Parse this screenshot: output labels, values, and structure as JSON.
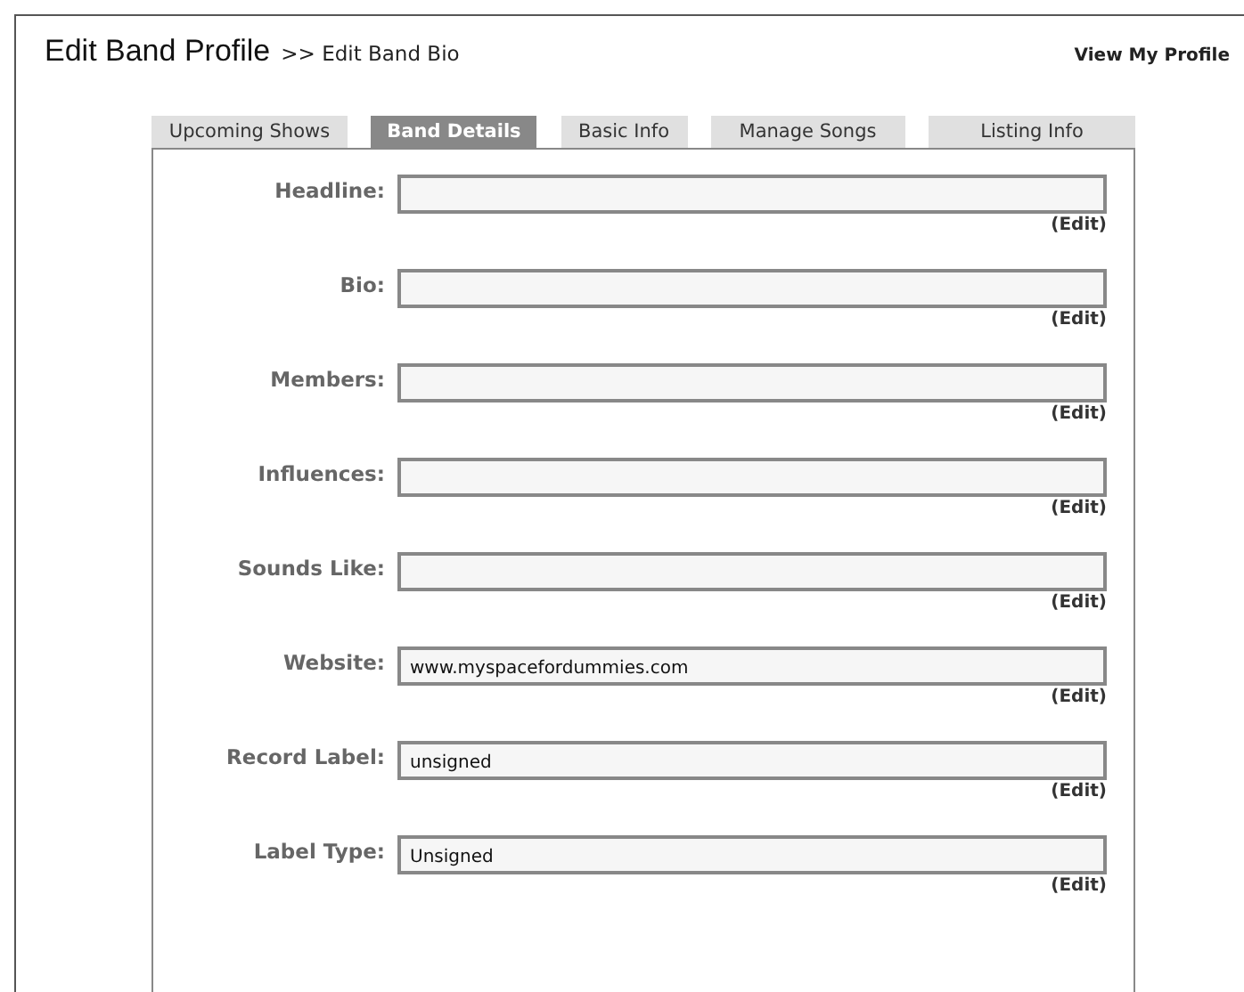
{
  "header": {
    "title": "Edit Band Profile",
    "breadcrumb": ">> Edit Band Bio",
    "link": "View My Profile"
  },
  "tabs": [
    {
      "label": "Upcoming Shows",
      "selected": false
    },
    {
      "label": "Band Details",
      "selected": true
    },
    {
      "label": "Basic Info",
      "selected": false
    },
    {
      "label": "Manage Songs",
      "selected": false
    },
    {
      "label": "Listing Info",
      "selected": false
    }
  ],
  "fields": [
    {
      "label": "Headline:",
      "edit": "(Edit)"
    },
    {
      "label": "Bio:",
      "edit": "(Edit)"
    },
    {
      "label": "Members:",
      "edit": "(Edit)"
    },
    {
      "label": "Influences:",
      "edit": "(Edit)"
    },
    {
      "label": "Sounds Like:",
      "edit": "(Edit)"
    },
    {
      "label": "Website:",
      "value": "www.myspacefordummies.com",
      "edit": "(Edit)"
    },
    {
      "label": "Record Label:",
      "value": "unsigned",
      "edit": "(Edit)"
    },
    {
      "label": "Label Type:",
      "value": "Unsigned",
      "edit": "(Edit)"
    }
  ]
}
